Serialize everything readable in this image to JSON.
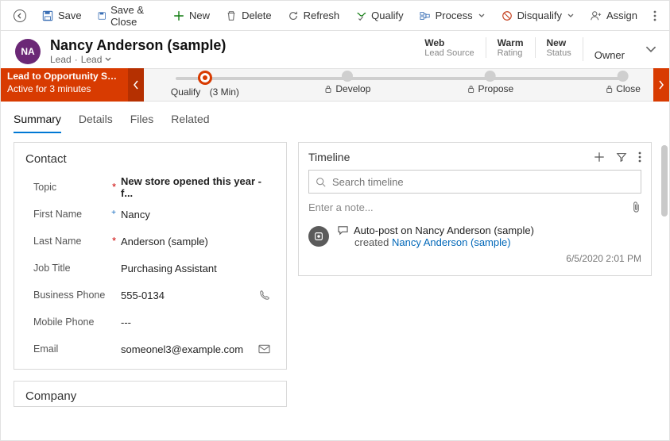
{
  "cmd": {
    "save": "Save",
    "save_close": "Save & Close",
    "new": "New",
    "delete": "Delete",
    "refresh": "Refresh",
    "qualify": "Qualify",
    "process": "Process",
    "disqualify": "Disqualify",
    "assign": "Assign"
  },
  "header": {
    "avatar_initials": "NA",
    "title": "Nancy Anderson (sample)",
    "entity": "Lead",
    "form_name": "Lead",
    "fields": {
      "lead_source": {
        "value": "Web",
        "label": "Lead Source"
      },
      "rating": {
        "value": "Warm",
        "label": "Rating"
      },
      "status": {
        "value": "New",
        "label": "Status"
      },
      "owner_label": "Owner"
    }
  },
  "bpf": {
    "flag_title": "Lead to Opportunity Sale...",
    "flag_sub": "Active for 3 minutes",
    "stages": {
      "qualify": "Qualify",
      "qualify_time": "(3 Min)",
      "develop": "Develop",
      "propose": "Propose",
      "close": "Close"
    }
  },
  "tabs": {
    "summary": "Summary",
    "details": "Details",
    "files": "Files",
    "related": "Related"
  },
  "contact": {
    "section_title": "Contact",
    "topic_label": "Topic",
    "topic_value": "New store opened this year - f...",
    "first_name_label": "First Name",
    "first_name_value": "Nancy",
    "last_name_label": "Last Name",
    "last_name_value": "Anderson (sample)",
    "job_title_label": "Job Title",
    "job_title_value": "Purchasing Assistant",
    "business_phone_label": "Business Phone",
    "business_phone_value": "555-0134",
    "mobile_phone_label": "Mobile Phone",
    "mobile_phone_value": "---",
    "email_label": "Email",
    "email_value": "someonel3@example.com"
  },
  "company": {
    "section_title": "Company"
  },
  "timeline": {
    "title": "Timeline",
    "search_placeholder": "Search timeline",
    "note_placeholder": "Enter a note...",
    "item": {
      "title": "Auto-post on Nancy Anderson (sample)",
      "created_prefix": "created ",
      "created_link": "Nancy Anderson (sample)",
      "timestamp": "6/5/2020 2:01 PM"
    }
  }
}
